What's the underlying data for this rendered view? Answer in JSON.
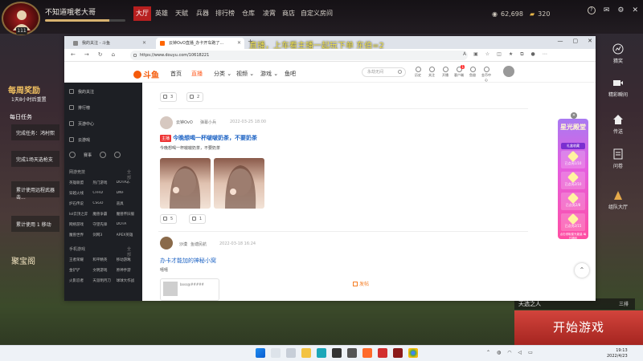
{
  "game": {
    "player": {
      "name": "不知道哦老大哥",
      "level": "111",
      "exp_fraction": 0.8
    },
    "nav": [
      "大厅",
      "英雄",
      "天赋",
      "兵器",
      "排行榜",
      "仓库",
      "凌霄",
      "商店",
      "自定义房间"
    ],
    "currency": [
      {
        "icon": "silver-icon",
        "value": "62,698"
      },
      {
        "icon": "gold-icon",
        "value": "320"
      }
    ],
    "weekly_reward": {
      "title": "每周奖励",
      "reset": "1天8小时后重置"
    },
    "daily": {
      "title": "每日任务"
    },
    "tasks": [
      "完成任务：鸿村熙",
      "完成1场天选枪支",
      "累计使用远程武器击...",
      "累计使用 1 移动"
    ],
    "treasure": "聚宝阁",
    "right_side": [
      {
        "label": "猜奖",
        "icon": "chart-icon"
      },
      {
        "label": "精彩瞬间",
        "icon": "video-icon"
      },
      {
        "label": "传送",
        "icon": "home-icon"
      },
      {
        "label": "问卷",
        "icon": "survey-icon"
      },
      {
        "label": "组队大厅",
        "icon": "team-icon"
      }
    ],
    "mode_title": "天选之人",
    "mode_right": "三排",
    "start_button": "开始游戏"
  },
  "browser": {
    "tabs": [
      {
        "label": "我的关注 - 斗鱼"
      },
      {
        "label": "云钟OvO直播_办卡开车跑了…"
      }
    ],
    "new_tab": "+",
    "danmu": "直播，上车看主播一起玩下单 东伯=2",
    "url": "https://www.douyu.com/10618221",
    "site": {
      "logo": "斗鱼",
      "nav": [
        "首页",
        "直播",
        "分类",
        "视频",
        "游戏",
        "鱼吧"
      ],
      "search_placeholder": "永劫无间",
      "header_icons": [
        {
          "label": "历史",
          "icon": "history-icon"
        },
        {
          "label": "关注",
          "icon": "follow-icon"
        },
        {
          "label": "开播",
          "icon": "broadcast-icon"
        },
        {
          "label": "客户端",
          "icon": "client-icon",
          "badge": "1"
        },
        {
          "label": "鱼翅",
          "icon": "currency-icon"
        },
        {
          "label": "金币中心",
          "icon": "coin-icon"
        }
      ],
      "sidebar": {
        "items": [
          "我的关注",
          "排行榜",
          "页游中心",
          "云游戏"
        ],
        "row": [
          "赛事"
        ],
        "sections": [
          {
            "title": "网游竞技",
            "more": "全部 >",
            "items": [
              "英雄联盟",
              "热门游戏",
              "DOTA2",
              "穿越火线",
              "CFHD",
              "DNF",
              "炉石传说",
              "CSGO",
              "道具",
              "lol云顶之弈",
              "魔兽争霸",
              "魔兽怀旧服",
              "网络游戏",
              "守望先锋",
              "DOTA",
              "魔兽世界",
              "剑网3",
              "APEX英雄"
            ]
          },
          {
            "title": "手机游戏",
            "more": "全部 >",
            "items": [
              "王者荣耀",
              "和平精英",
              "移动游戏",
              "金铲铲",
              "文明游戏",
              "原神手游",
              "火影忍者",
              "天涯明月刀",
              "球球大作战"
            ]
          }
        ]
      }
    },
    "feed": {
      "top": {
        "likes": "3",
        "comments": "2"
      },
      "post1": {
        "author": "云钟OvO",
        "tag": "弹幕小兵",
        "time": "2022-03-25 18:00",
        "badge": "主播",
        "title": "今晚想喝一杯啵啵奶茶，不要奶茶",
        "text": "今晚想喝一杯啵啵奶茶，不要奶茶",
        "likes": "5",
        "comments": "1"
      },
      "post2": {
        "author": "沙漠",
        "tag": "鱼塘民航",
        "time": "2022-03-18 16:24",
        "title": "办卡才能加的神秘小窝",
        "text": "嘻嘻",
        "card_text": "boss@#####"
      },
      "post_button": "发帖"
    },
    "promo": {
      "title": "星光殿堂",
      "subtitle": "礼盒收藏",
      "items": [
        "已点亮1/10",
        "已点亮2/10",
        "已点亮2/8",
        "已点亮2/15"
      ],
      "footer": "点击领取星光能量 每日福利"
    }
  },
  "taskbar": {
    "time": "19:13",
    "date": "2022/4/23"
  },
  "colors": {
    "accent": "#ff5d23",
    "game_red": "#b71f1f",
    "link": "#1d63c4"
  }
}
